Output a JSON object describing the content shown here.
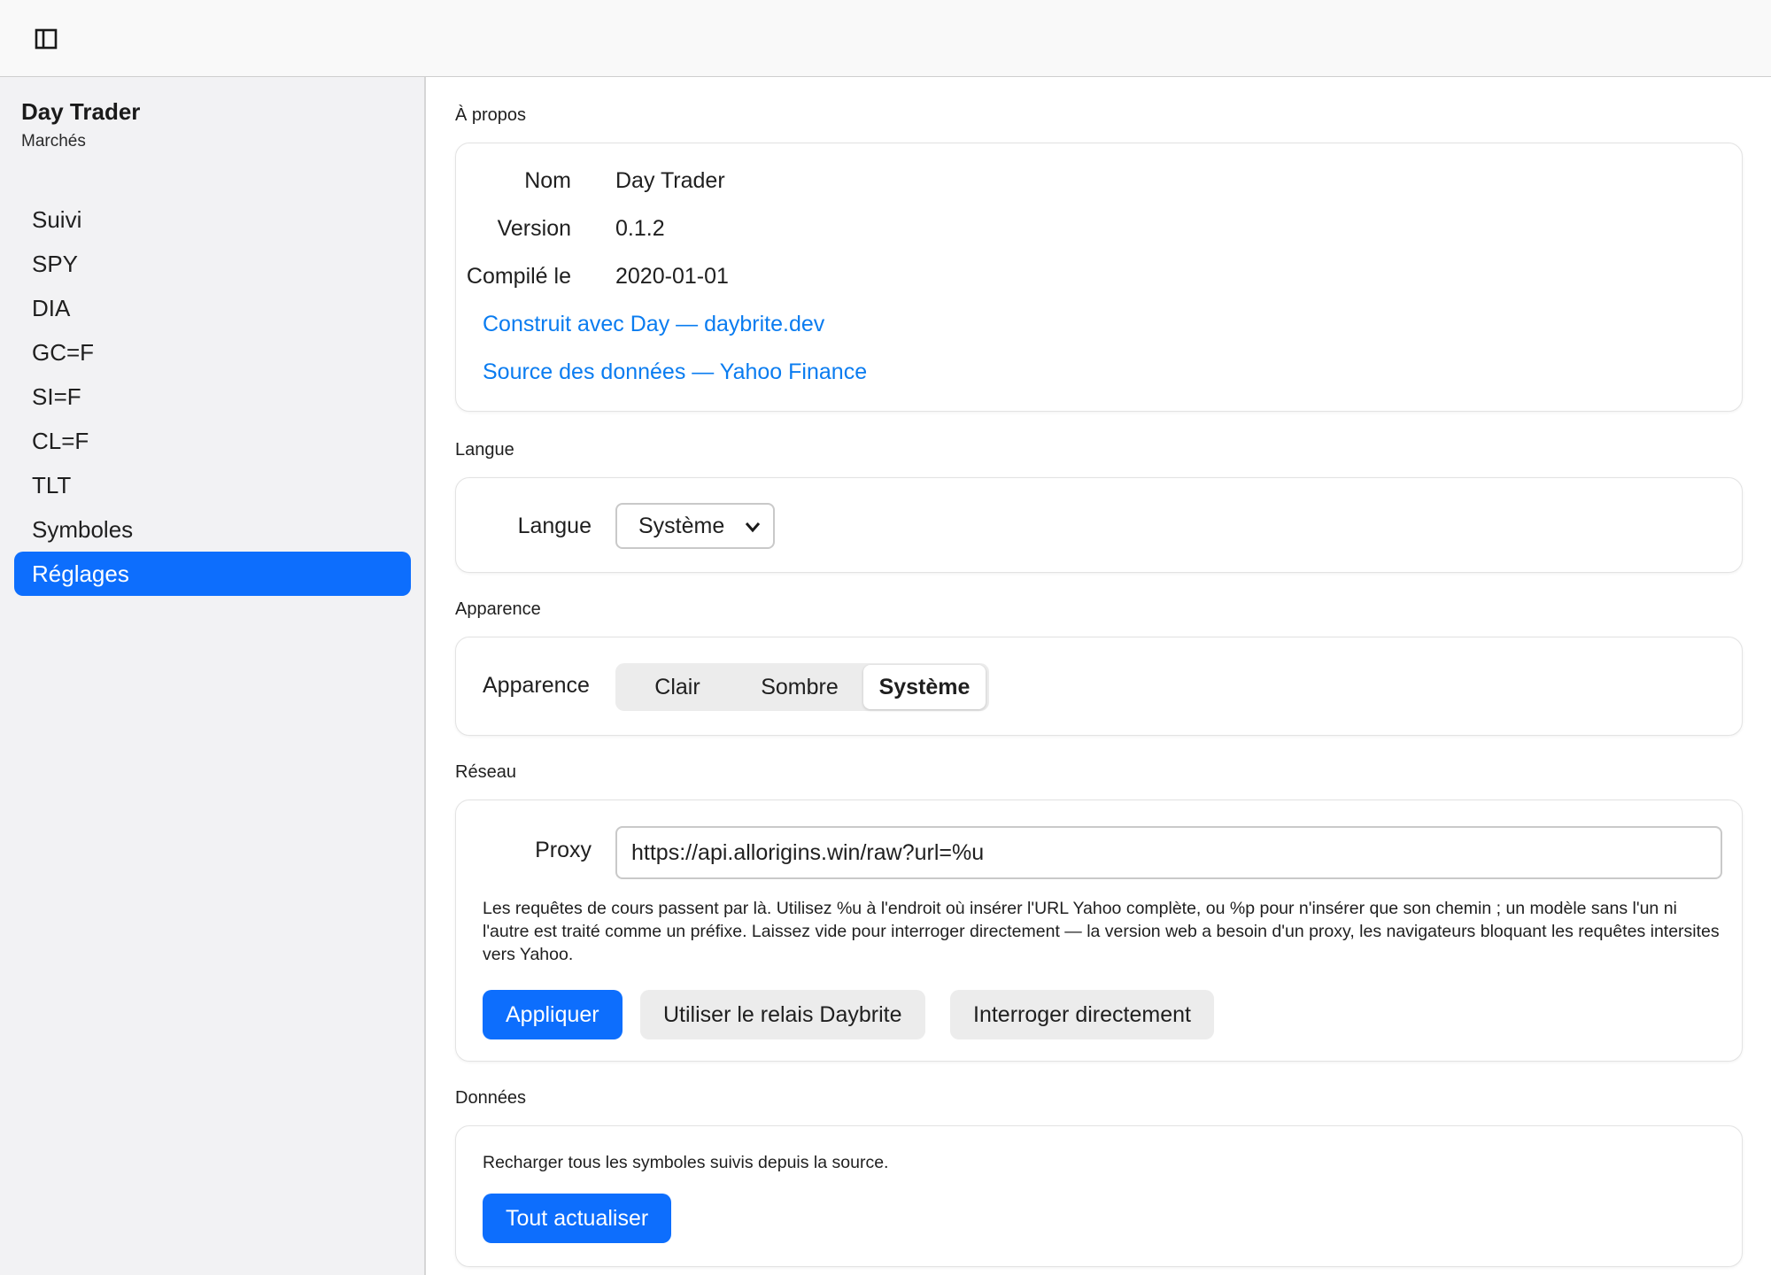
{
  "sidebar": {
    "app_title": "Day Trader",
    "app_subtitle": "Marchés",
    "items": [
      {
        "label": "Suivi"
      },
      {
        "label": "SPY"
      },
      {
        "label": "DIA"
      },
      {
        "label": "GC=F"
      },
      {
        "label": "SI=F"
      },
      {
        "label": "CL=F"
      },
      {
        "label": "TLT"
      },
      {
        "label": "Symboles"
      },
      {
        "label": "Réglages",
        "active": true
      }
    ]
  },
  "about": {
    "section_label": "À propos",
    "name_key": "Nom",
    "name_value": "Day Trader",
    "version_key": "Version",
    "version_value": "0.1.2",
    "compiled_key": "Compilé le",
    "compiled_value": "2020-01-01",
    "built_with_link": "Construit avec Day — daybrite.dev",
    "data_source_link": "Source des données — Yahoo Finance"
  },
  "language": {
    "section_label": "Langue",
    "field_label": "Langue",
    "selected": "Système"
  },
  "appearance": {
    "section_label": "Apparence",
    "field_label": "Apparence",
    "options": [
      "Clair",
      "Sombre",
      "Système"
    ],
    "selected": "Système"
  },
  "network": {
    "section_label": "Réseau",
    "field_label": "Proxy",
    "proxy_value": "https://api.allorigins.win/raw?url=%u",
    "help": "Les requêtes de cours passent par là. Utilisez %u à l'endroit où insérer l'URL Yahoo complète, ou %p pour n'insérer que son chemin ; un modèle sans l'un ni l'autre est traité comme un préfixe. Laissez vide pour interroger directement — la version web a besoin d'un proxy, les navigateurs bloquant les requêtes intersites vers Yahoo.",
    "apply_label": "Appliquer",
    "relay_label": "Utiliser le relais Daybrite",
    "direct_label": "Interroger directement"
  },
  "data_section": {
    "section_label": "Données",
    "description": "Recharger tous les symboles suivis depuis la source.",
    "refresh_label": "Tout actualiser"
  },
  "colors": {
    "accent": "#0d6efd",
    "link": "#0a7cf0",
    "sidebar_bg": "#f2f2f4"
  },
  "icons": {
    "sidebar_toggle": "sidebar-toggle-icon",
    "select_chevron": "chevron-down-icon"
  }
}
